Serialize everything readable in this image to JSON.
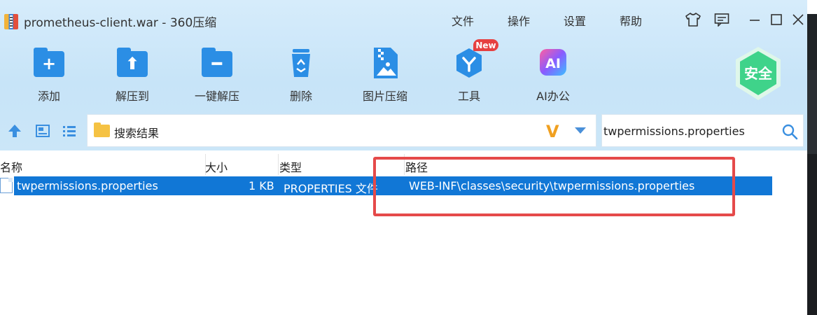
{
  "window": {
    "title": "prometheus-client.war - 360压缩"
  },
  "menu": [
    "文件",
    "操作",
    "设置",
    "帮助"
  ],
  "toolbar": {
    "add": "添加",
    "extract_to": "解压到",
    "one_click_extract": "一键解压",
    "delete": "删除",
    "image_compress": "图片压缩",
    "tools": "工具",
    "tools_badge": "New",
    "ai_office": "AI办公",
    "ai_icon_text": "AI",
    "safe": "安全"
  },
  "address": {
    "path": "搜索结果",
    "logo": "V"
  },
  "search": {
    "value": "twpermissions.properties"
  },
  "columns": [
    "名称",
    "大小",
    "类型",
    "路径"
  ],
  "rows": [
    {
      "name": "twpermissions.properties",
      "size": "1 KB",
      "type": "PROPERTIES 文件",
      "path": "WEB-INF\\classes\\security\\twpermissions.properties"
    }
  ],
  "colors": {
    "accent": "#2b8ee5",
    "selection": "#1177d6",
    "highlight_box": "#e54a4a",
    "safe_badge": "#3fd38a"
  }
}
